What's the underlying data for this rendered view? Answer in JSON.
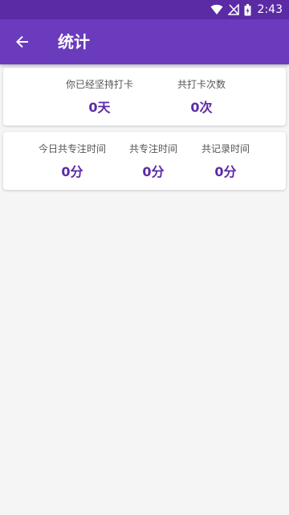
{
  "status_bar": {
    "time": "2:43",
    "icons": [
      "wifi-icon",
      "no-signal-icon",
      "battery-charging-icon"
    ]
  },
  "app_bar": {
    "title": "统计",
    "back_icon": "arrow-left-icon",
    "background_color": "#6a3bbd"
  },
  "card_checkin": {
    "streak_label": "你已经坚持打卡",
    "streak_value": "0天",
    "total_label": "共打卡次数",
    "total_value": "0次"
  },
  "card_focus": {
    "today_label": "今日共专注时间",
    "today_value": "0分",
    "total_focus_label": "共专注时间",
    "total_focus_value": "0分",
    "total_record_label": "共记录时间",
    "total_record_value": "0分"
  },
  "colors": {
    "accent": "#5b2ba6",
    "background": "#f5f5f5",
    "card": "#ffffff"
  }
}
